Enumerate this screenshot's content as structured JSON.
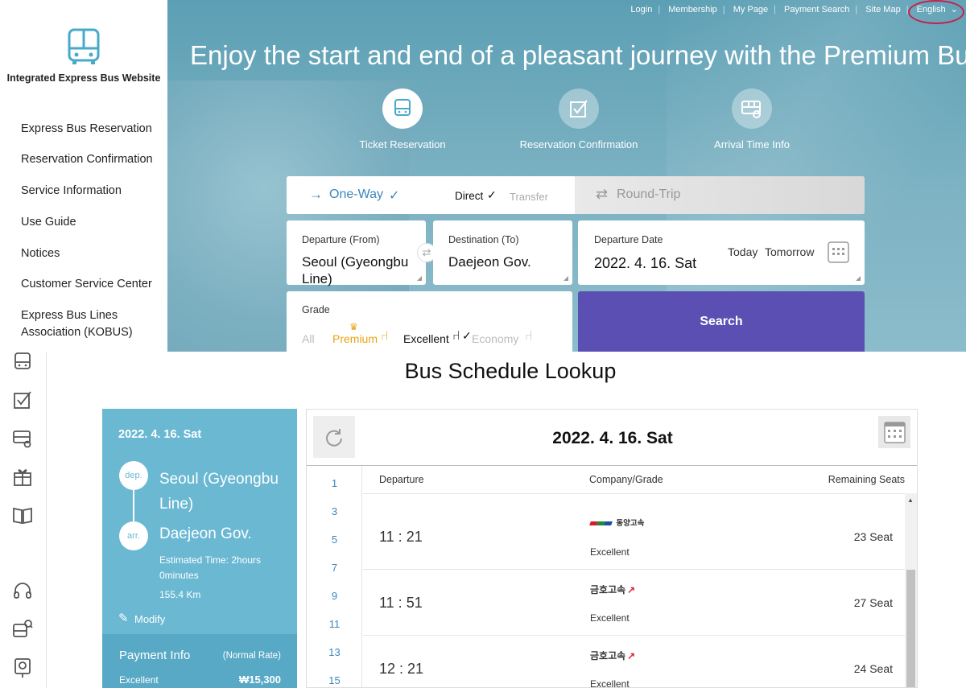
{
  "sidebar": {
    "site_name": "Integrated Express Bus Website",
    "items": [
      {
        "label": "Express Bus Reservation"
      },
      {
        "label": "Reservation Confirmation"
      },
      {
        "label": "Service Information"
      },
      {
        "label": "Use Guide"
      },
      {
        "label": "Notices"
      },
      {
        "label": "Customer Service Center"
      },
      {
        "label": "Express Bus Lines Association (KOBUS)"
      }
    ]
  },
  "top_links": {
    "login": "Login",
    "membership": "Membership",
    "my_page": "My Page",
    "payment_search": "Payment Search",
    "site_map": "Site Map",
    "language": "English"
  },
  "hero": {
    "title": "Enjoy the start and end of a pleasant journey with the Premium Bus!",
    "nav": [
      {
        "label": "Ticket Reservation",
        "icon": "bus-icon"
      },
      {
        "label": "Reservation Confirmation",
        "icon": "checkbox-icon"
      },
      {
        "label": "Arrival Time Info",
        "icon": "bus-arrival-icon"
      }
    ]
  },
  "booking": {
    "one_way_label": "One-Way",
    "direct_label": "Direct",
    "transfer_label": "Transfer",
    "round_trip_label": "Round-Trip",
    "departure_label": "Departure (From)",
    "departure_value": "Seoul (Gyeongbu Line)",
    "destination_label": "Destination (To)",
    "destination_value": "Daejeon Gov.",
    "date_label": "Departure Date",
    "date_value": "2022. 4. 16. Sat",
    "today_label": "Today",
    "tomorrow_label": "Tomorrow",
    "grade_label": "Grade",
    "grades": [
      "All",
      "Premium",
      "Excellent",
      "Economy"
    ],
    "selected_grade": "Excellent",
    "search_label": "Search"
  },
  "schedule": {
    "title": "Bus Schedule Lookup",
    "route": {
      "date": "2022. 4. 16. Sat",
      "dep_tag": "dep.",
      "departure": "Seoul (Gyeongbu Line)",
      "arr_tag": "arr.",
      "arrival": "Daejeon Gov.",
      "estimated_time_1": "Estimated Time: 2hours",
      "estimated_time_2": "0minutes",
      "distance": "155.4 Km",
      "modify_label": "Modify"
    },
    "payment": {
      "label": "Payment Info",
      "rate": "(Normal Rate)",
      "grade": "Excellent",
      "price": "₩15,300"
    },
    "table_date": "2022. 4. 16. Sat",
    "hours": [
      "1",
      "3",
      "5",
      "7",
      "9",
      "11",
      "13",
      "15"
    ],
    "columns": {
      "departure": "Departure",
      "company": "Company/Grade",
      "seats": "Remaining Seats"
    },
    "rows": [
      {
        "time": "11 : 21",
        "company": "동양고속",
        "grade": "Excellent",
        "seats": "23 Seat"
      },
      {
        "time": "11 : 51",
        "company": "금호고속",
        "grade": "Excellent",
        "seats": "27 Seat"
      },
      {
        "time": "12 : 21",
        "company": "금호고속",
        "grade": "Excellent",
        "seats": "24 Seat"
      }
    ]
  },
  "colors": {
    "hero": "#6aa8bb",
    "search_button": "#5b4fb3",
    "route_panel": "#6bb8d3",
    "accent_link": "#3a86c0",
    "premium": "#e8a317",
    "language_highlight": "#c4214f"
  }
}
